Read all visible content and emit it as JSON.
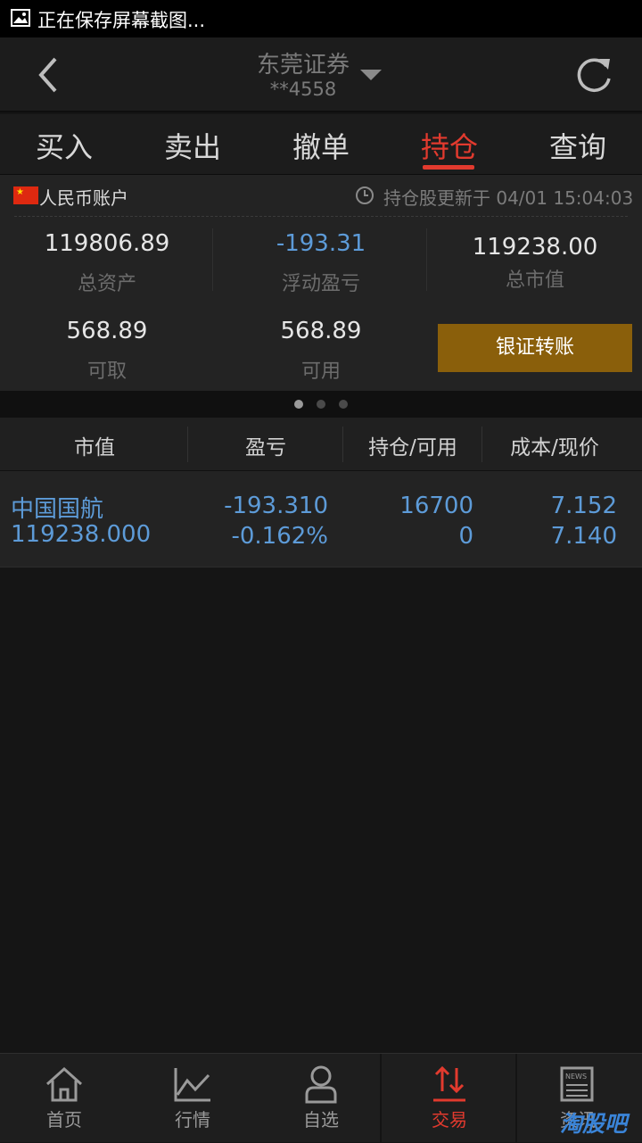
{
  "status_bar": {
    "text": "正在保存屏幕截图..."
  },
  "nav": {
    "title": "东莞证券",
    "account": "**4558"
  },
  "tabs": [
    "买入",
    "卖出",
    "撤单",
    "持仓",
    "查询"
  ],
  "account": {
    "currency": "人民币账户",
    "update_text": "持仓股更新于 04/01 15:04:03",
    "total_assets": {
      "value": "119806.89",
      "label": "总资产"
    },
    "floating_pl": {
      "value": "-193.31",
      "label": "浮动盈亏"
    },
    "market_value": {
      "value": "119238.00",
      "label": "总市值"
    },
    "withdrawable": {
      "value": "568.89",
      "label": "可取"
    },
    "available": {
      "value": "568.89",
      "label": "可用"
    },
    "transfer_button": "银证转账"
  },
  "table": {
    "headers": [
      "市值",
      "盈亏",
      "持仓/可用",
      "成本/现价"
    ],
    "rows": [
      {
        "name": "中国国航",
        "market_value": "119238.000",
        "pl": "-193.310",
        "pl_pct": "-0.162%",
        "position": "16700",
        "available": "0",
        "cost": "7.152",
        "price": "7.140"
      }
    ]
  },
  "bottom_nav": [
    "首页",
    "行情",
    "自选",
    "交易",
    "资讯"
  ],
  "watermark": "淘股吧",
  "colors": {
    "accent": "#e23a2e",
    "value_blue": "#5d9bd8",
    "button_gold": "#8a5f0b"
  },
  "icons": [
    "image-icon",
    "back-icon",
    "dropdown-caret-icon",
    "refresh-icon",
    "china-flag-icon",
    "clock-icon",
    "home-icon",
    "chart-icon",
    "person-icon",
    "trade-arrows-icon",
    "news-icon"
  ]
}
